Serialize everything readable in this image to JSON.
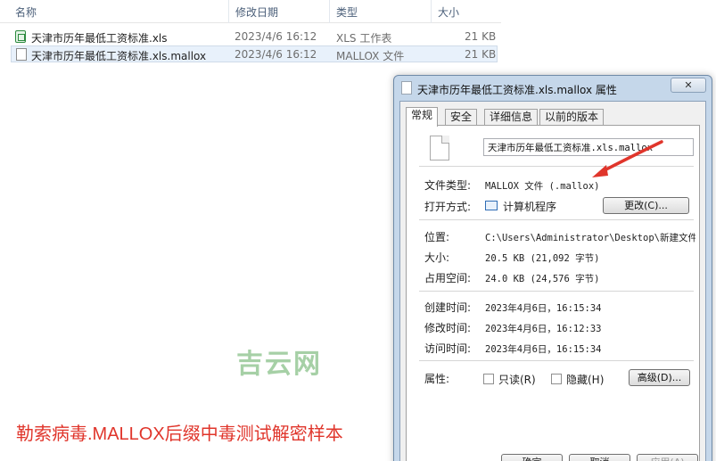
{
  "explorer": {
    "columns": {
      "name": "名称",
      "modified": "修改日期",
      "type": "类型",
      "size": "大小"
    },
    "files": [
      {
        "name": "天津市历年最低工资标准.xls",
        "modified": "2023/4/6 16:12",
        "type": "XLS 工作表",
        "size": "21 KB",
        "icon": "xls-file-icon"
      },
      {
        "name": "天津市历年最低工资标准.xls.mallox",
        "modified": "2023/4/6 16:12",
        "type": "MALLOX 文件",
        "size": "21 KB",
        "icon": "generic-file-icon"
      }
    ]
  },
  "watermark": "吉云网",
  "caption": "勒索病毒.MALLOX后缀中毒测试解密样本",
  "dialog": {
    "title": "天津市历年最低工资标准.xls.mallox 属性",
    "close": "✕",
    "tabs": [
      "常规",
      "安全",
      "详细信息",
      "以前的版本"
    ],
    "file_name": "天津市历年最低工资标准.xls.mallox",
    "fields": {
      "type_label": "文件类型:",
      "type_value": "MALLOX 文件 (.mallox)",
      "open_with_label": "打开方式:",
      "open_with_value": "计算机程序",
      "change_button": "更改(C)...",
      "location_label": "位置:",
      "location_value": "C:\\Users\\Administrator\\Desktop\\新建文件夹",
      "size_label": "大小:",
      "size_value": "20.5 KB (21,092 字节)",
      "disk_size_label": "占用空间:",
      "disk_size_value": "24.0 KB (24,576 字节)",
      "created_label": "创建时间:",
      "created_value": "2023年4月6日，16:15:34",
      "modified_label": "修改时间:",
      "modified_value": "2023年4月6日，16:12:33",
      "accessed_label": "访问时间:",
      "accessed_value": "2023年4月6日，16:15:34",
      "attributes_label": "属性:",
      "readonly_label": "只读(R)",
      "hidden_label": "隐藏(H)",
      "advanced_button": "高级(D)..."
    },
    "buttons": {
      "ok": "确定",
      "cancel": "取消",
      "apply": "应用(A)"
    }
  },
  "colors": {
    "caption": "#e0352b",
    "arrow": "#e0352b",
    "watermark": "#a6d0a6",
    "dialog_frame": "#c5d7ea"
  }
}
